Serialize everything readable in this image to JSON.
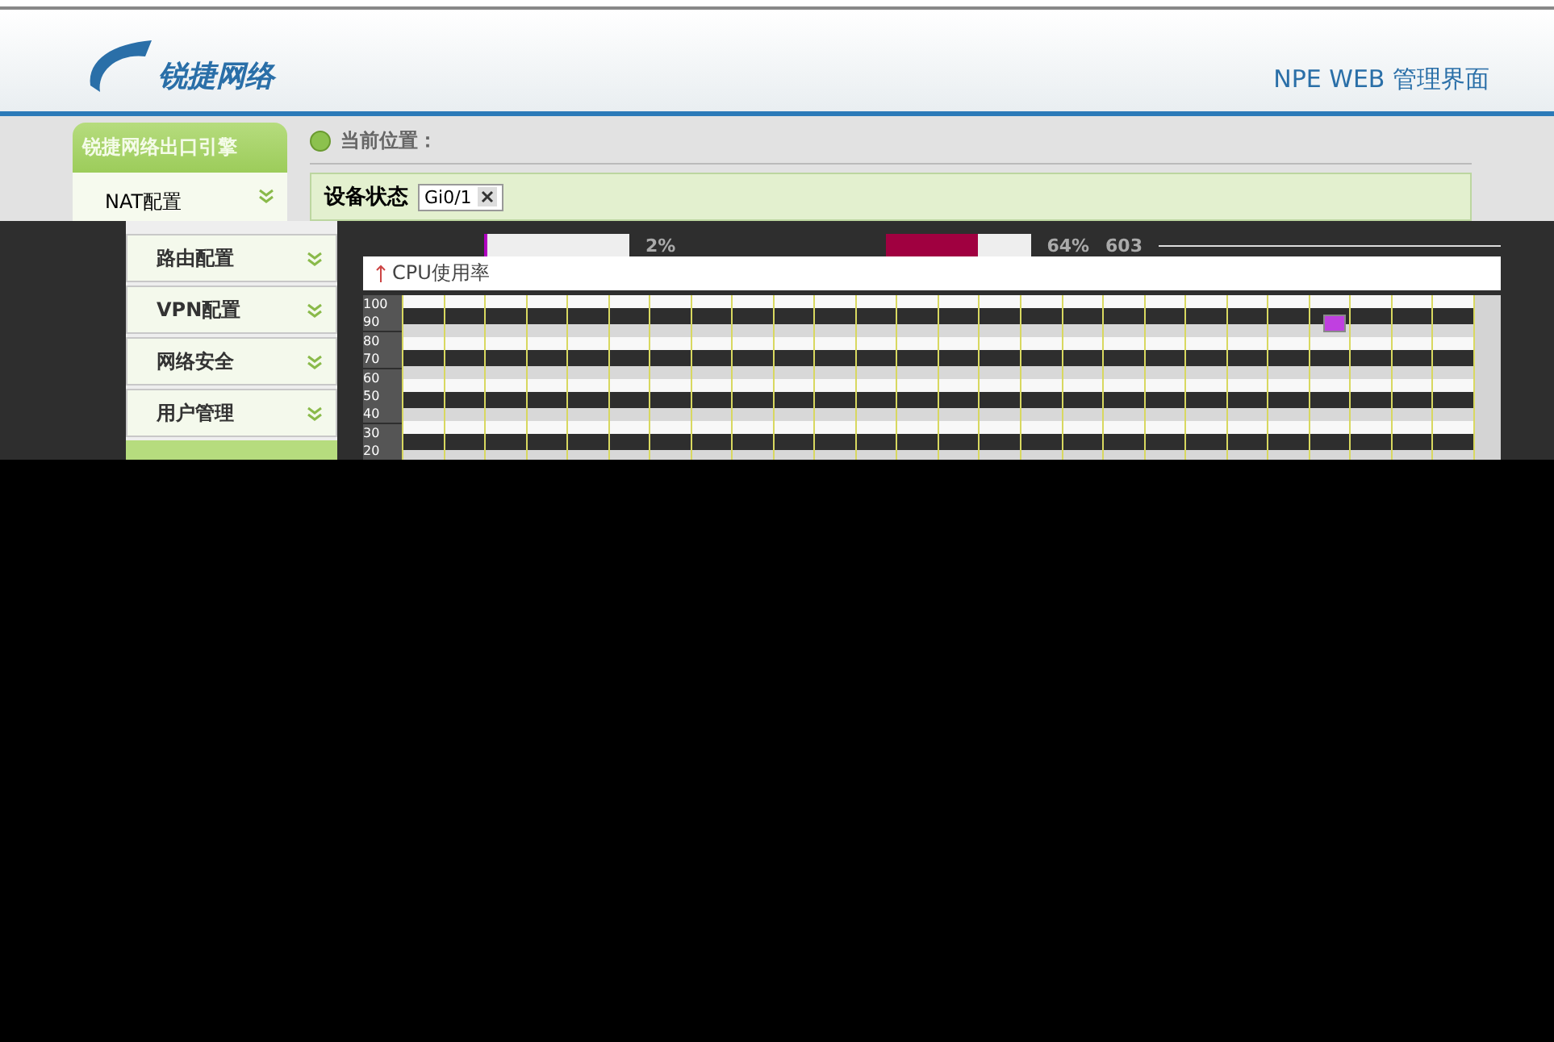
{
  "header": {
    "logo_text": "锐捷网络",
    "title": "NPE WEB 管理界面"
  },
  "sidebar": {
    "title": "锐捷网络出口引擎",
    "items": [
      "NAT配置"
    ]
  },
  "breadcrumb": {
    "label": "当前位置："
  },
  "device_status": {
    "label": "设备状态",
    "interface": "Gi0/1"
  },
  "menu": {
    "items": [
      "路由配置",
      "VPN配置",
      "网络安全",
      "用户管理"
    ]
  },
  "stats": [
    {
      "value": "2%",
      "level": 0.02
    },
    {
      "value": "64%",
      "level": 0.64
    },
    {
      "value": "603"
    }
  ],
  "chart": {
    "title": "CPU使用率",
    "y_labels": [
      "100",
      "90",
      "80",
      "70",
      "60",
      "50",
      "40",
      "30",
      "20"
    ]
  }
}
